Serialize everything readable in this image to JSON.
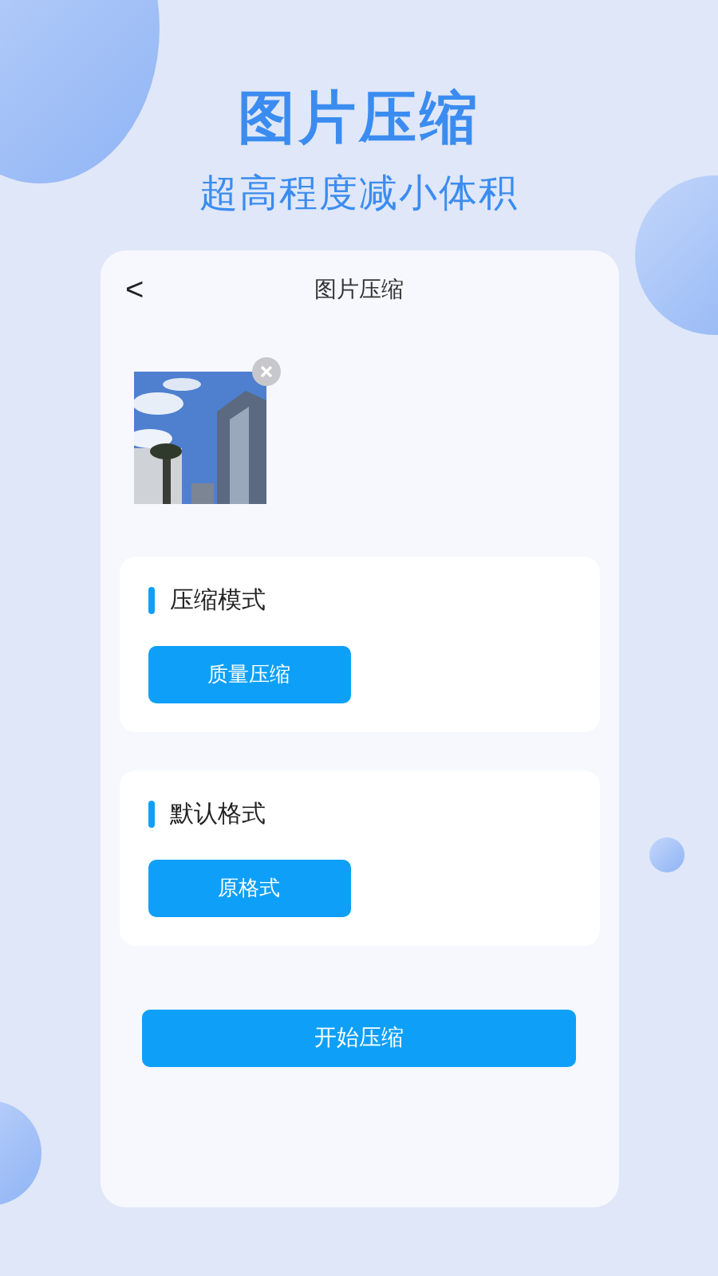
{
  "hero": {
    "title": "图片压缩",
    "subtitle": "超高程度减小体积"
  },
  "card": {
    "back": "<",
    "title": "图片压缩",
    "images": [
      {
        "kind": "picture",
        "removable": true
      }
    ],
    "sections": [
      {
        "heading": "压缩模式",
        "option": "质量压缩"
      },
      {
        "heading": "默认格式",
        "option": "原格式"
      }
    ],
    "start_button": "开始压缩"
  }
}
